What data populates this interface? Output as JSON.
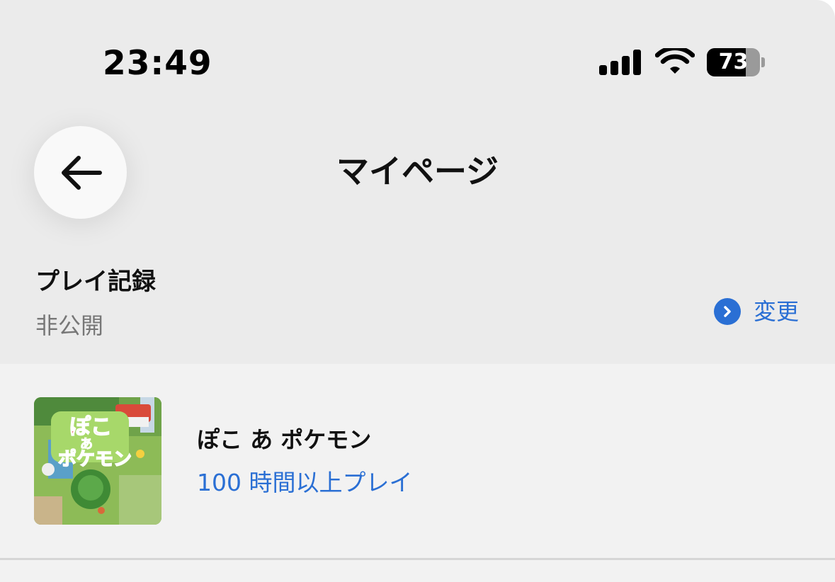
{
  "status_bar": {
    "time": "23:49",
    "battery_level": "73",
    "battery_fraction": 0.73,
    "signal_icon": "cellular-signal-icon",
    "wifi_icon": "wifi-icon",
    "battery_icon": "battery-icon"
  },
  "nav": {
    "back_icon": "back-arrow-icon",
    "title": "マイページ"
  },
  "play_record": {
    "title": "プレイ記録",
    "visibility": "非公開",
    "change_label": "変更",
    "change_icon": "chevron-right-circle-icon"
  },
  "games": [
    {
      "name": "ぽこ あ ポケモン",
      "playtime": "100 時間以上プレイ",
      "thumbnail_icon": "game-cover-art"
    }
  ],
  "colors": {
    "background": "#ebebeb",
    "list_background": "#f2f2f2",
    "accent": "#2a6fd4",
    "secondary_text": "#777777"
  }
}
